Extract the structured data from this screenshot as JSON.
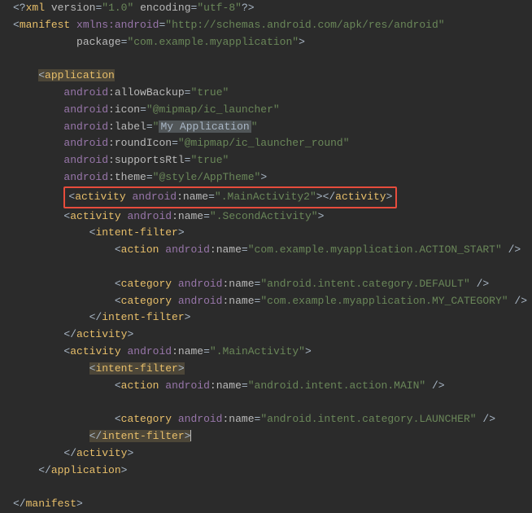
{
  "xml_decl": {
    "version": "1.0",
    "encoding": "utf-8"
  },
  "manifest": {
    "xmlns_android_url": "http://schemas.android.com/apk/res/android",
    "package": "com.example.myapplication"
  },
  "application": {
    "allowBackup": "true",
    "icon": "@mipmap/ic_launcher",
    "label_display": "My Application",
    "roundIcon": "@mipmap/ic_launcher_round",
    "supportsRtl": "true",
    "theme": "@style/AppTheme"
  },
  "activities": [
    {
      "name": ".MainActivity2",
      "highlighted": true
    },
    {
      "name": ".SecondActivity",
      "intent_filter": {
        "action": "com.example.myapplication.ACTION_START",
        "categories": [
          "android.intent.category.DEFAULT",
          "com.example.myapplication.MY_CATEGORY"
        ]
      }
    },
    {
      "name": ".MainActivity",
      "intent_filter": {
        "action": "android.intent.action.MAIN",
        "categories": [
          "android.intent.category.LAUNCHER"
        ]
      }
    }
  ],
  "tags": {
    "manifest": "manifest",
    "application": "application",
    "activity": "activity",
    "intent_filter": "intent-filter",
    "action": "action",
    "category": "category"
  },
  "attrs": {
    "xmlns_android": "xmlns:android",
    "package": "package",
    "android_prefix": "android",
    "allowBackup": "allowBackup",
    "icon": "icon",
    "label": "label",
    "roundIcon": "roundIcon",
    "supportsRtl": "supportsRtl",
    "theme": "theme",
    "name": "name"
  }
}
